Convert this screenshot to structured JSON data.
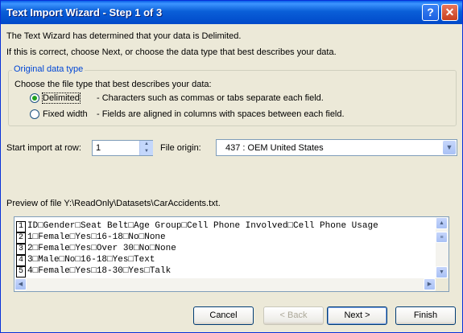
{
  "window": {
    "title": "Text Import Wizard - Step 1 of 3",
    "help_glyph": "?",
    "close_glyph": "✕"
  },
  "intro": {
    "line1": "The Text Wizard has determined that your data is Delimited.",
    "line2": "If this is correct, choose Next, or choose the data type that best describes your data."
  },
  "original_data_type": {
    "legend": "Original data type",
    "prompt": "Choose the file type that best describes your data:",
    "options": [
      {
        "label": "Delimited",
        "description": "- Characters such as commas or tabs separate each field.",
        "selected": true
      },
      {
        "label": "Fixed width",
        "description": "- Fields are aligned in columns with spaces between each field.",
        "selected": false
      }
    ]
  },
  "start_row": {
    "label": "Start import at row:",
    "value": "1"
  },
  "file_origin": {
    "label": "File origin:",
    "value": "437 : OEM United States"
  },
  "preview": {
    "label": "Preview of file Y:\\ReadOnly\\Datasets\\CarAccidents.txt.",
    "rows": [
      {
        "num": "1",
        "text": "ID□Gender□Seat Belt□Age Group□Cell Phone Involved□Cell Phone Usage"
      },
      {
        "num": "2",
        "text": "1□Female□Yes□16-18□No□None"
      },
      {
        "num": "3",
        "text": "2□Female□Yes□Over 30□No□None"
      },
      {
        "num": "4",
        "text": "3□Male□No□16-18□Yes□Text"
      },
      {
        "num": "5",
        "text": "4□Female□Yes□18-30□Yes□Talk"
      }
    ]
  },
  "buttons": {
    "cancel": "Cancel",
    "back": "< Back",
    "next": "Next >",
    "finish": "Finish"
  },
  "icons": [
    "help-icon",
    "close-icon",
    "spin-up-icon",
    "spin-down-icon",
    "dropdown-arrow-icon",
    "scroll-up-icon",
    "scroll-down-icon",
    "scroll-left-icon",
    "scroll-right-icon"
  ]
}
